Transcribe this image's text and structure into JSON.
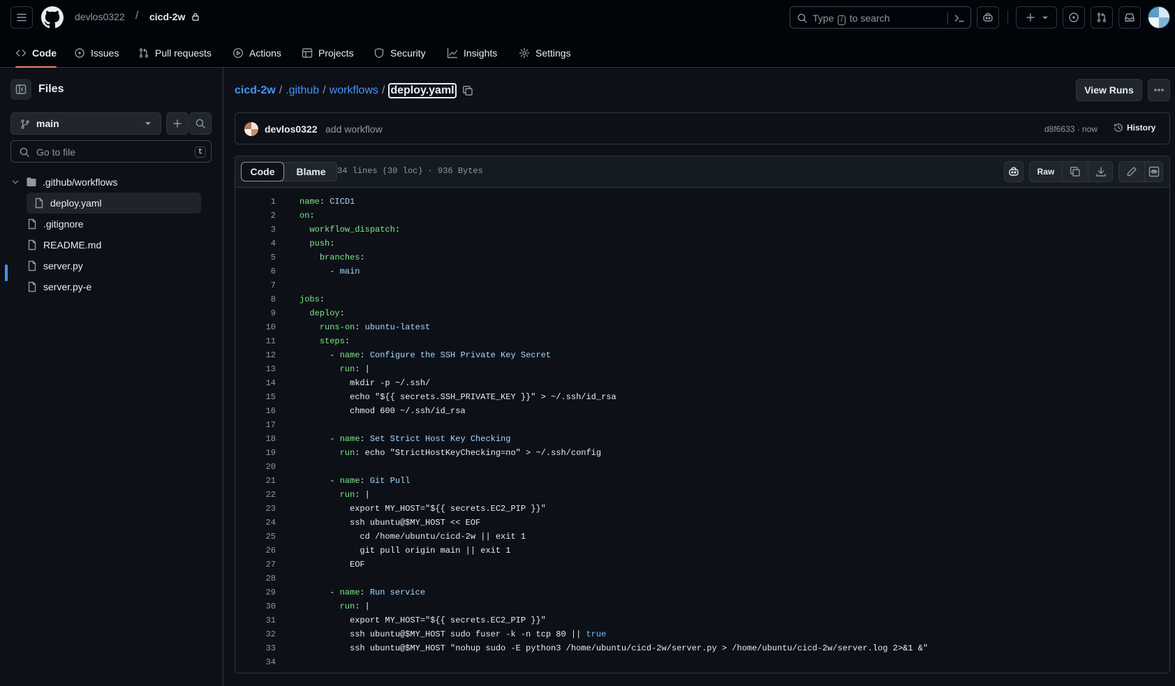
{
  "header": {
    "owner": "devlos0322",
    "separator": "/",
    "repo": "cicd-2w",
    "search": {
      "prefix": "Type",
      "key": "/",
      "suffix": "to search"
    }
  },
  "repo_nav": [
    {
      "label": "Code",
      "icon": "code-icon",
      "active": true
    },
    {
      "label": "Issues",
      "icon": "issue-opened-icon"
    },
    {
      "label": "Pull requests",
      "icon": "git-pull-request-icon"
    },
    {
      "label": "Actions",
      "icon": "play-icon"
    },
    {
      "label": "Projects",
      "icon": "table-icon"
    },
    {
      "label": "Security",
      "icon": "shield-icon"
    },
    {
      "label": "Insights",
      "icon": "graph-icon"
    },
    {
      "label": "Settings",
      "icon": "gear-icon"
    }
  ],
  "sidebar": {
    "title": "Files",
    "branch": "main",
    "goto_placeholder": "Go to file",
    "goto_shortcut": "t",
    "tree": [
      {
        "label": ".github/workflows",
        "type": "folder"
      },
      {
        "label": "deploy.yaml",
        "type": "file",
        "selected": true
      },
      {
        "label": ".gitignore",
        "type": "file"
      },
      {
        "label": "README.md",
        "type": "file"
      },
      {
        "label": "server.py",
        "type": "file"
      },
      {
        "label": "server.py-e",
        "type": "file"
      }
    ]
  },
  "breadcrumb": {
    "repo": "cicd-2w",
    "dir1": ".github",
    "dir2": "workflows",
    "file": "deploy.yaml",
    "sep": "/"
  },
  "actions": {
    "view_runs": "View Runs"
  },
  "commit": {
    "author": "devlos0322",
    "message": "add workflow",
    "meta": "d8f6633 · now",
    "history_label": "History"
  },
  "file": {
    "tab_code": "Code",
    "tab_blame": "Blame",
    "stats": "34 lines (30 loc) · 936 Bytes",
    "raw_label": "Raw"
  },
  "colors": {
    "accent": "#4493f8",
    "tab_underline": "#f78166",
    "yaml_key": "#7ee787",
    "yaml_value": "#a5d6ff",
    "yaml_constant": "#79c0ff"
  },
  "code_lines": [
    {
      "n": "1",
      "text": "name: CICD1"
    },
    {
      "n": "2",
      "text": "on:"
    },
    {
      "n": "3",
      "text": "  workflow_dispatch:"
    },
    {
      "n": "4",
      "text": "  push:"
    },
    {
      "n": "5",
      "text": "    branches:"
    },
    {
      "n": "6",
      "text": "      - main"
    },
    {
      "n": "7",
      "text": ""
    },
    {
      "n": "8",
      "text": "jobs:"
    },
    {
      "n": "9",
      "text": "  deploy:"
    },
    {
      "n": "10",
      "text": "    runs-on: ubuntu-latest"
    },
    {
      "n": "11",
      "text": "    steps:"
    },
    {
      "n": "12",
      "text": "      - name: Configure the SSH Private Key Secret"
    },
    {
      "n": "13",
      "text": "        run: |"
    },
    {
      "n": "14",
      "text": "          mkdir -p ~/.ssh/"
    },
    {
      "n": "15",
      "text": "          echo \"${{ secrets.SSH_PRIVATE_KEY }}\" > ~/.ssh/id_rsa"
    },
    {
      "n": "16",
      "text": "          chmod 600 ~/.ssh/id_rsa"
    },
    {
      "n": "17",
      "text": ""
    },
    {
      "n": "18",
      "text": "      - name: Set Strict Host Key Checking"
    },
    {
      "n": "19",
      "text": "        run: echo \"StrictHostKeyChecking=no\" > ~/.ssh/config"
    },
    {
      "n": "20",
      "text": ""
    },
    {
      "n": "21",
      "text": "      - name: Git Pull"
    },
    {
      "n": "22",
      "text": "        run: |"
    },
    {
      "n": "23",
      "text": "          export MY_HOST=\"${{ secrets.EC2_PIP }}\""
    },
    {
      "n": "24",
      "text": "          ssh ubuntu@$MY_HOST << EOF"
    },
    {
      "n": "25",
      "text": "            cd /home/ubuntu/cicd-2w || exit 1"
    },
    {
      "n": "26",
      "text": "            git pull origin main || exit 1"
    },
    {
      "n": "27",
      "text": "          EOF"
    },
    {
      "n": "28",
      "text": ""
    },
    {
      "n": "29",
      "text": "      - name: Run service"
    },
    {
      "n": "30",
      "text": "        run: |"
    },
    {
      "n": "31",
      "text": "          export MY_HOST=\"${{ secrets.EC2_PIP }}\""
    },
    {
      "n": "32",
      "text": "          ssh ubuntu@$MY_HOST sudo fuser -k -n tcp 80 || true"
    },
    {
      "n": "33",
      "text": "          ssh ubuntu@$MY_HOST \"nohup sudo -E python3 /home/ubuntu/cicd-2w/server.py > /home/ubuntu/cicd-2w/server.log 2>&1 &\""
    },
    {
      "n": "34",
      "text": ""
    }
  ]
}
